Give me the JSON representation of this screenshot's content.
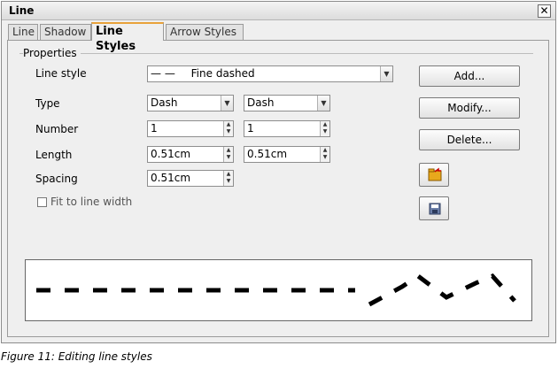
{
  "dialog": {
    "title": "Line",
    "close_glyph": "✕"
  },
  "tabs": [
    {
      "label": "Line",
      "active": false
    },
    {
      "label": "Shadow",
      "active": false
    },
    {
      "label": "Line Styles",
      "active": true
    },
    {
      "label": "Arrow Styles",
      "active": false
    }
  ],
  "properties": {
    "group_label": "Properties",
    "line_style_label": "Line style",
    "line_style_value": "Fine dashed",
    "line_style_preview_glyph": "—  —",
    "type_label": "Type",
    "type_value_1": "Dash",
    "type_value_2": "Dash",
    "number_label": "Number",
    "number_value_1": "1",
    "number_value_2": "1",
    "length_label": "Length",
    "length_value_1": "0.51cm",
    "length_value_2": "0.51cm",
    "spacing_label": "Spacing",
    "spacing_value": "0.51cm",
    "fit_label": "Fit to line width",
    "fit_checked": false
  },
  "buttons": {
    "add": "Add...",
    "modify": "Modify...",
    "delete": "Delete...",
    "load_icon": "folder-open-icon",
    "save_icon": "floppy-disk-icon"
  },
  "caption": "Figure 11: Editing line styles"
}
